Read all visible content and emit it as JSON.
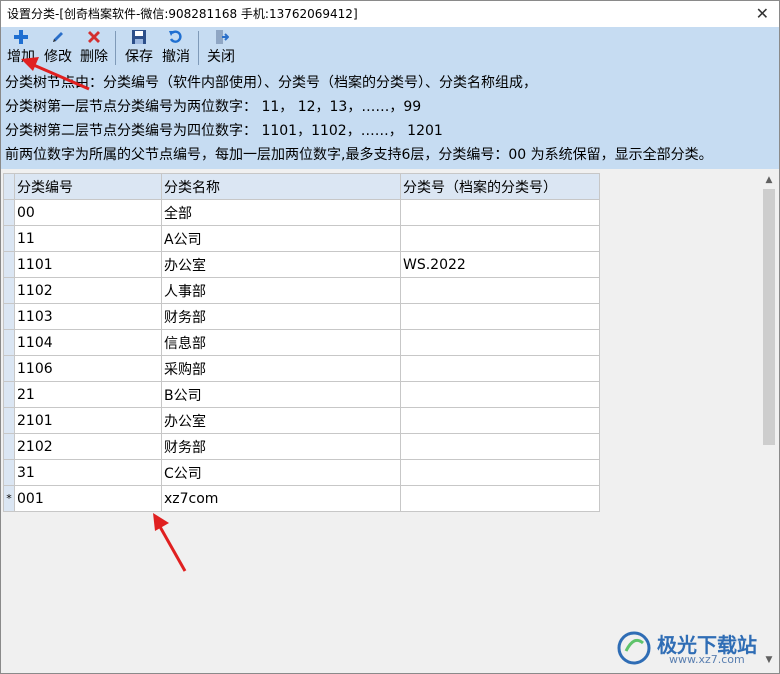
{
  "window": {
    "title": "设置分类-[创奇档案软件-微信:908281168 手机:13762069412]",
    "close_glyph": "✕"
  },
  "toolbar": {
    "add": "增加",
    "edit": "修改",
    "delete": "删除",
    "save": "保存",
    "undo": "撤消",
    "close": "关闭"
  },
  "info": [
    "分类树节点由：分类编号（软件内部使用）、分类号（档案的分类号）、分类名称组成，",
    "分类树第一层节点分类编号为两位数字： 11， 12，13，……，99",
    "分类树第二层节点分类编号为四位数字： 1101，1102，……， 1201",
    "前两位数字为所属的父节点编号，每加一层加两位数字,最多支持6层，分类编号：00 为系统保留，显示全部分类。"
  ],
  "grid": {
    "headers": [
      "分类编号",
      "分类名称",
      "分类号（档案的分类号）"
    ],
    "new_row_marker": "*",
    "rows": [
      [
        "00",
        "全部",
        ""
      ],
      [
        "11",
        "A公司",
        ""
      ],
      [
        "1101",
        "办公室",
        "WS.2022"
      ],
      [
        "1102",
        "人事部",
        ""
      ],
      [
        "1103",
        "财务部",
        ""
      ],
      [
        "1104",
        "信息部",
        ""
      ],
      [
        "1106",
        "采购部",
        ""
      ],
      [
        "21",
        "B公司",
        ""
      ],
      [
        "2101",
        "办公室",
        ""
      ],
      [
        "2102",
        "财务部",
        ""
      ],
      [
        "31",
        "C公司",
        ""
      ],
      [
        "001",
        "xz7com",
        ""
      ]
    ]
  },
  "watermark": {
    "name": "极光下载站",
    "url": "www.xz7.com"
  },
  "colors": {
    "accent": "#2f6db5",
    "arrow": "#e02020",
    "toolbar_bg": "#c6dcf2"
  }
}
